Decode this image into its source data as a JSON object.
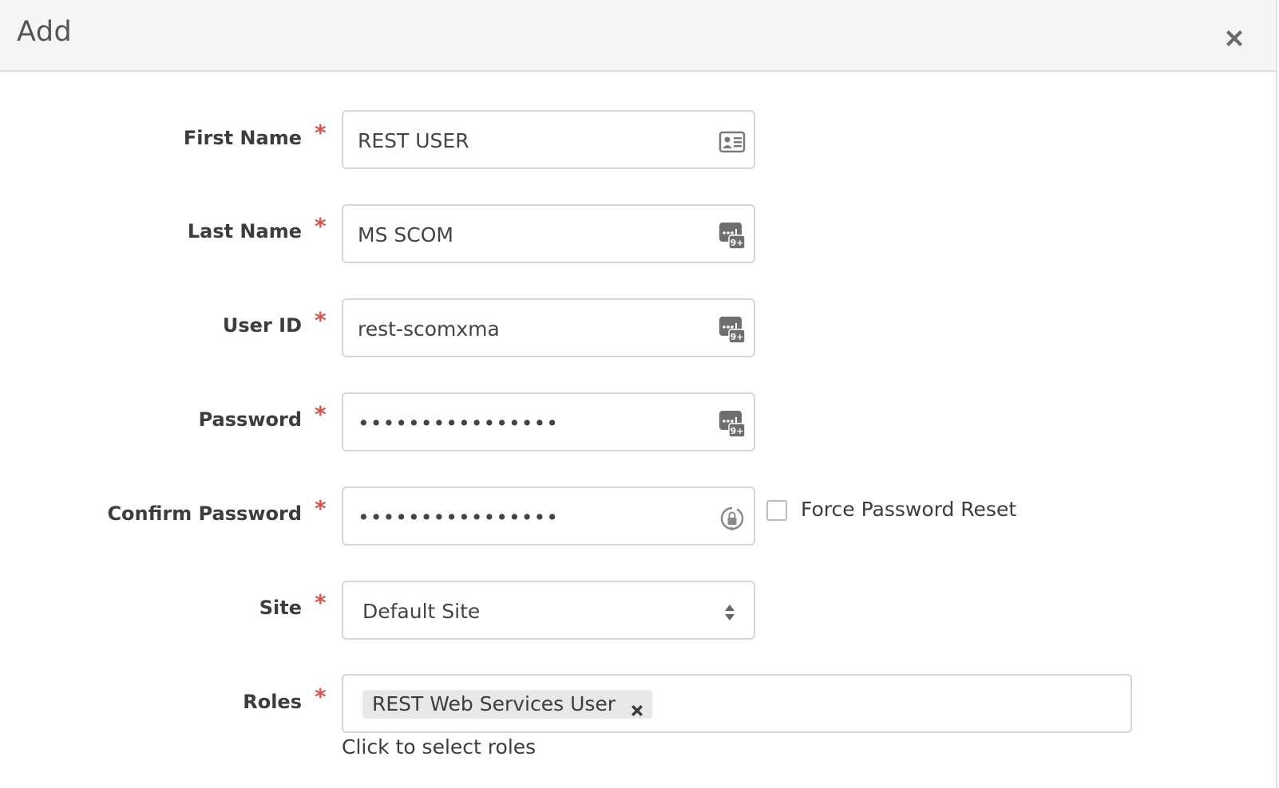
{
  "dialog": {
    "title": "Add",
    "close_icon": "close-icon"
  },
  "form": {
    "required_marker": "*",
    "first_name": {
      "label": "First Name",
      "value": "REST USER",
      "icon": "contact-card-icon"
    },
    "last_name": {
      "label": "Last Name",
      "value": "MS SCOM",
      "icon": "password-manager-icon"
    },
    "user_id": {
      "label": "User ID",
      "value": "rest-scomxma",
      "icon": "password-manager-icon"
    },
    "password": {
      "label": "Password",
      "value": "••••••••••••••••",
      "icon": "password-manager-icon"
    },
    "confirm_password": {
      "label": "Confirm Password",
      "value": "••••••••••••••••",
      "icon": "password-generator-icon"
    },
    "force_reset": {
      "label": "Force Password Reset",
      "checked": false
    },
    "site": {
      "label": "Site",
      "value": "Default Site"
    },
    "roles": {
      "label": "Roles",
      "selected": [
        "REST Web Services User"
      ],
      "hint": "Click to select roles"
    }
  },
  "colors": {
    "required": "#d9534f",
    "header_bg": "#f5f5f5",
    "border": "#d6d6d6",
    "tag_bg": "#e8e8e8"
  }
}
